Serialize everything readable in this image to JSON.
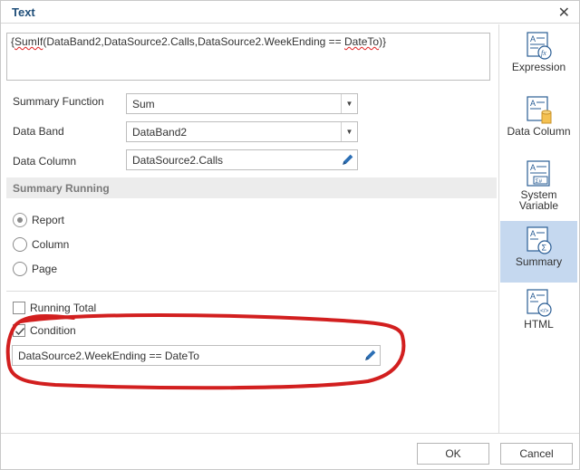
{
  "dialog": {
    "title": "Text",
    "close_glyph": "✕"
  },
  "expression": {
    "prefix": "{",
    "fn": "SumIf",
    "middle": "(DataBand2,DataSource2.Calls,DataSource2.WeekEnding == ",
    "arg": "DateTo",
    "suffix": ")}"
  },
  "form": {
    "summary_function_label": "Summary Function",
    "summary_function_value": "Sum",
    "data_band_label": "Data Band",
    "data_band_value": "DataBand2",
    "data_column_label": "Data Column",
    "data_column_value": "DataSource2.Calls"
  },
  "summary_running": {
    "title": "Summary Running",
    "options": [
      "Report",
      "Column",
      "Page"
    ],
    "selected": "Report"
  },
  "options": {
    "running_total_label": "Running Total",
    "running_total_checked": false,
    "condition_label": "Condition",
    "condition_checked": true,
    "condition_value": "DataSource2.WeekEnding == DateTo"
  },
  "sidebar": {
    "items": [
      {
        "label": "Expression",
        "icon": "expression-icon"
      },
      {
        "label": "Data Column",
        "icon": "data-column-icon"
      },
      {
        "label": "System Variable",
        "icon": "system-variable-icon"
      },
      {
        "label": "Summary",
        "icon": "summary-icon",
        "active": true
      },
      {
        "label": "HTML",
        "icon": "html-icon"
      }
    ]
  },
  "buttons": {
    "ok": "OK",
    "cancel": "Cancel"
  },
  "colors": {
    "accent_active": "#c5d8ef",
    "annotation": "#d21f1f",
    "title": "#1f4e79"
  }
}
